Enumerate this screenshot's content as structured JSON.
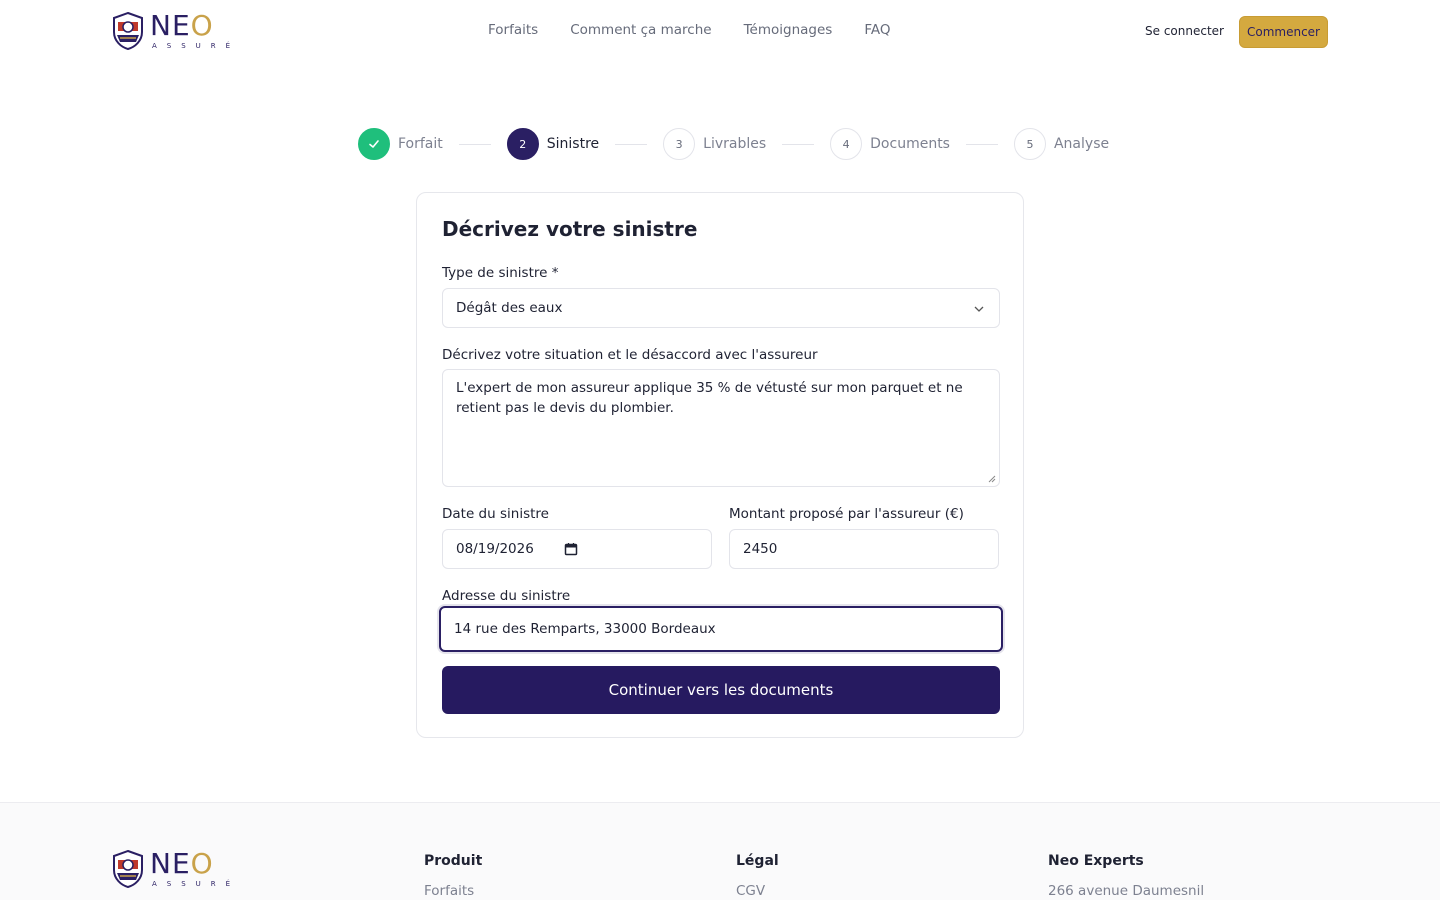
{
  "brand": {
    "word_left": "NE",
    "word_right": "O",
    "tagline": "ASSURÉ"
  },
  "nav": {
    "items": [
      "Forfaits",
      "Comment ça marche",
      "Témoignages",
      "FAQ"
    ]
  },
  "header": {
    "signin": "Se connecter",
    "start": "Commencer"
  },
  "stepper": {
    "steps": [
      {
        "num": "",
        "label": "Forfait",
        "state": "done"
      },
      {
        "num": "2",
        "label": "Sinistre",
        "state": "active"
      },
      {
        "num": "3",
        "label": "Livrables",
        "state": "todo"
      },
      {
        "num": "4",
        "label": "Documents",
        "state": "todo"
      },
      {
        "num": "5",
        "label": "Analyse",
        "state": "todo"
      }
    ]
  },
  "form": {
    "title": "Décrivez votre sinistre",
    "type_label": "Type de sinistre *",
    "type_value": "Dégât des eaux",
    "desc_label": "Décrivez votre situation et le désaccord avec l'assureur",
    "desc_value": "L'expert de mon assureur applique 35 % de vétusté sur mon parquet et ne retient pas le devis du plombier.",
    "date_label": "Date du sinistre",
    "date_value": "08/19/2026",
    "amount_label": "Montant proposé par l'assureur (€)",
    "amount_value": "2450",
    "address_label": "Adresse du sinistre",
    "address_value": "14 rue des Remparts, 33000 Bordeaux",
    "submit": "Continuer vers les documents"
  },
  "footer": {
    "produit": {
      "title": "Produit",
      "first": "Forfaits"
    },
    "legal": {
      "title": "Légal",
      "first": "CGV"
    },
    "experts": {
      "title": "Neo Experts",
      "first": "266 avenue Daumesnil"
    }
  },
  "colors": {
    "primary": "#261a60",
    "accent": "#d4a93f",
    "success": "#1fbf7c"
  }
}
